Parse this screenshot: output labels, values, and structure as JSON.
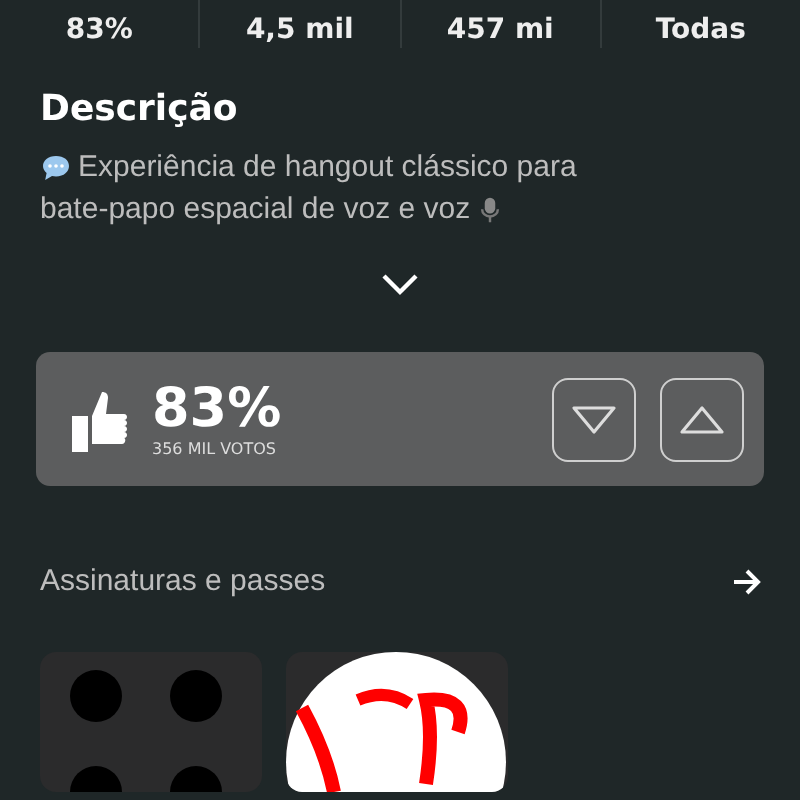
{
  "stats": [
    {
      "value": "83%"
    },
    {
      "value": "4,5 mil"
    },
    {
      "value": "457 mi"
    },
    {
      "value": "Todas"
    }
  ],
  "description": {
    "title": "Descrição",
    "lines": [
      "Experiência de hangout clássico para",
      "bate-papo espacial de voz e voz"
    ],
    "expanded": false
  },
  "rating": {
    "percent": "83%",
    "votes": "356 MIL VOTOS"
  },
  "passes": {
    "title": "Assinaturas e passes"
  }
}
